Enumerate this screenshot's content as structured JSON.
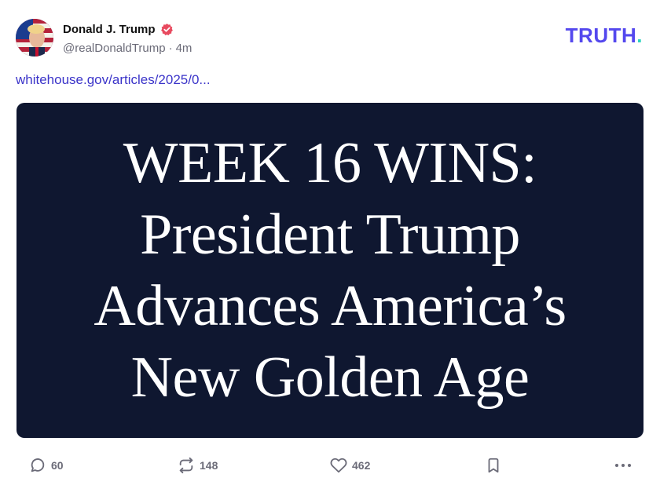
{
  "author": {
    "display_name": "Donald J. Trump",
    "handle": "@realDonaldTrump",
    "separator": "·",
    "time_ago": "4m",
    "verified_badge_color": "#e84a5f"
  },
  "brand": {
    "logo_text": "TRUTH",
    "logo_dot": ".",
    "logo_color": "#5448ee",
    "dot_color": "#2dd4bf"
  },
  "post": {
    "link_text": "whitehouse.gov/articles/2025/0...",
    "link_color": "#3b34c9",
    "media": {
      "background": "#0f1730",
      "headline_lines": [
        "WEEK 16 WINS:",
        "President Trump",
        "Advances America’s",
        "New Golden Age"
      ]
    }
  },
  "actions": {
    "replies": "60",
    "retruths": "148",
    "likes": "462"
  },
  "icons": {
    "reply": "comment-icon",
    "retruth": "repost-icon",
    "like": "heart-icon",
    "bookmark": "bookmark-icon",
    "more": "more-icon"
  }
}
